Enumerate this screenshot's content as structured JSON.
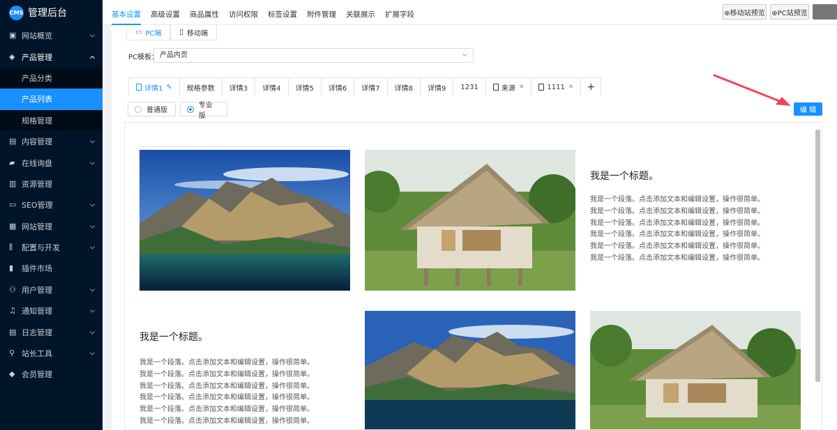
{
  "app": {
    "logo_badge": "CMS",
    "title": "管理后台"
  },
  "sidebar": {
    "items": [
      {
        "label": "网站概览",
        "icon": "dashboard-icon",
        "has_arrow": true
      },
      {
        "label": "产品管理",
        "icon": "cube-icon",
        "has_arrow": true,
        "open": true
      },
      {
        "label": "内容管理",
        "icon": "document-icon",
        "has_arrow": true
      },
      {
        "label": "在线询盘",
        "icon": "chat-icon",
        "has_arrow": true
      },
      {
        "label": "资源管理",
        "icon": "folder-icon",
        "has_arrow": false
      },
      {
        "label": "SEO管理",
        "icon": "monitor-icon",
        "has_arrow": true
      },
      {
        "label": "网站管理",
        "icon": "browser-icon",
        "has_arrow": true
      },
      {
        "label": "配置与开发",
        "icon": "sliders-icon",
        "has_arrow": true
      },
      {
        "label": "插件市场",
        "icon": "lock-icon",
        "has_arrow": false
      },
      {
        "label": "用户管理",
        "icon": "user-icon",
        "has_arrow": true
      },
      {
        "label": "通知管理",
        "icon": "bell-icon",
        "has_arrow": true
      },
      {
        "label": "日志管理",
        "icon": "log-icon",
        "has_arrow": true
      },
      {
        "label": "站长工具",
        "icon": "tools-icon",
        "has_arrow": true
      },
      {
        "label": "会员管理",
        "icon": "member-icon",
        "has_arrow": false
      }
    ],
    "submenu": [
      "产品分类",
      "产品列表",
      "规格管理"
    ],
    "active_sub": "产品列表"
  },
  "topbar": {
    "tabs": [
      "基本设置",
      "高级设置",
      "商品属性",
      "访问权限",
      "标签设置",
      "附件管理",
      "关联展示",
      "扩展字段"
    ],
    "active_tab": "基本设置",
    "mobile_preview": "⊕移动站预览",
    "pc_preview": "⊕PC站预览"
  },
  "device_tabs": {
    "pc": "PC端",
    "mobile": "移动端",
    "active": "PC端"
  },
  "template": {
    "label": "PC模板：",
    "value": "产品内页"
  },
  "detail_tabs": [
    "详情1",
    "规格参数",
    "详情3",
    "详情4",
    "详情5",
    "详情6",
    "详情7",
    "详情8",
    "详情9",
    "1231",
    "来源",
    "1111"
  ],
  "detail_active": "详情1",
  "plus_label": "+",
  "edition": {
    "normal": "普通版",
    "pro": "专业版",
    "selected": "专业版"
  },
  "edit_button": "编 辑",
  "content": {
    "title_1": "我是一个标题。",
    "title_2": "我是一个标题。",
    "paragraph_lines": [
      "我是一个段落。点击添加文本和编辑设置，操作很简单。",
      "我是一个段落。点击添加文本和编辑设置，操作很简单。",
      "我是一个段落。点击添加文本和编辑设置，操作很简单。",
      "我是一个段落。点击添加文本和编辑设置，操作很简单。",
      "我是一个段落。点击添加文本和编辑设置，操作很简单。",
      "我是一个段落。点击添加文本和编辑设置，操作很简单。"
    ]
  },
  "colors": {
    "sidebar_bg": "#001529",
    "accent": "#1890ff",
    "arrow": "#f0445a"
  }
}
